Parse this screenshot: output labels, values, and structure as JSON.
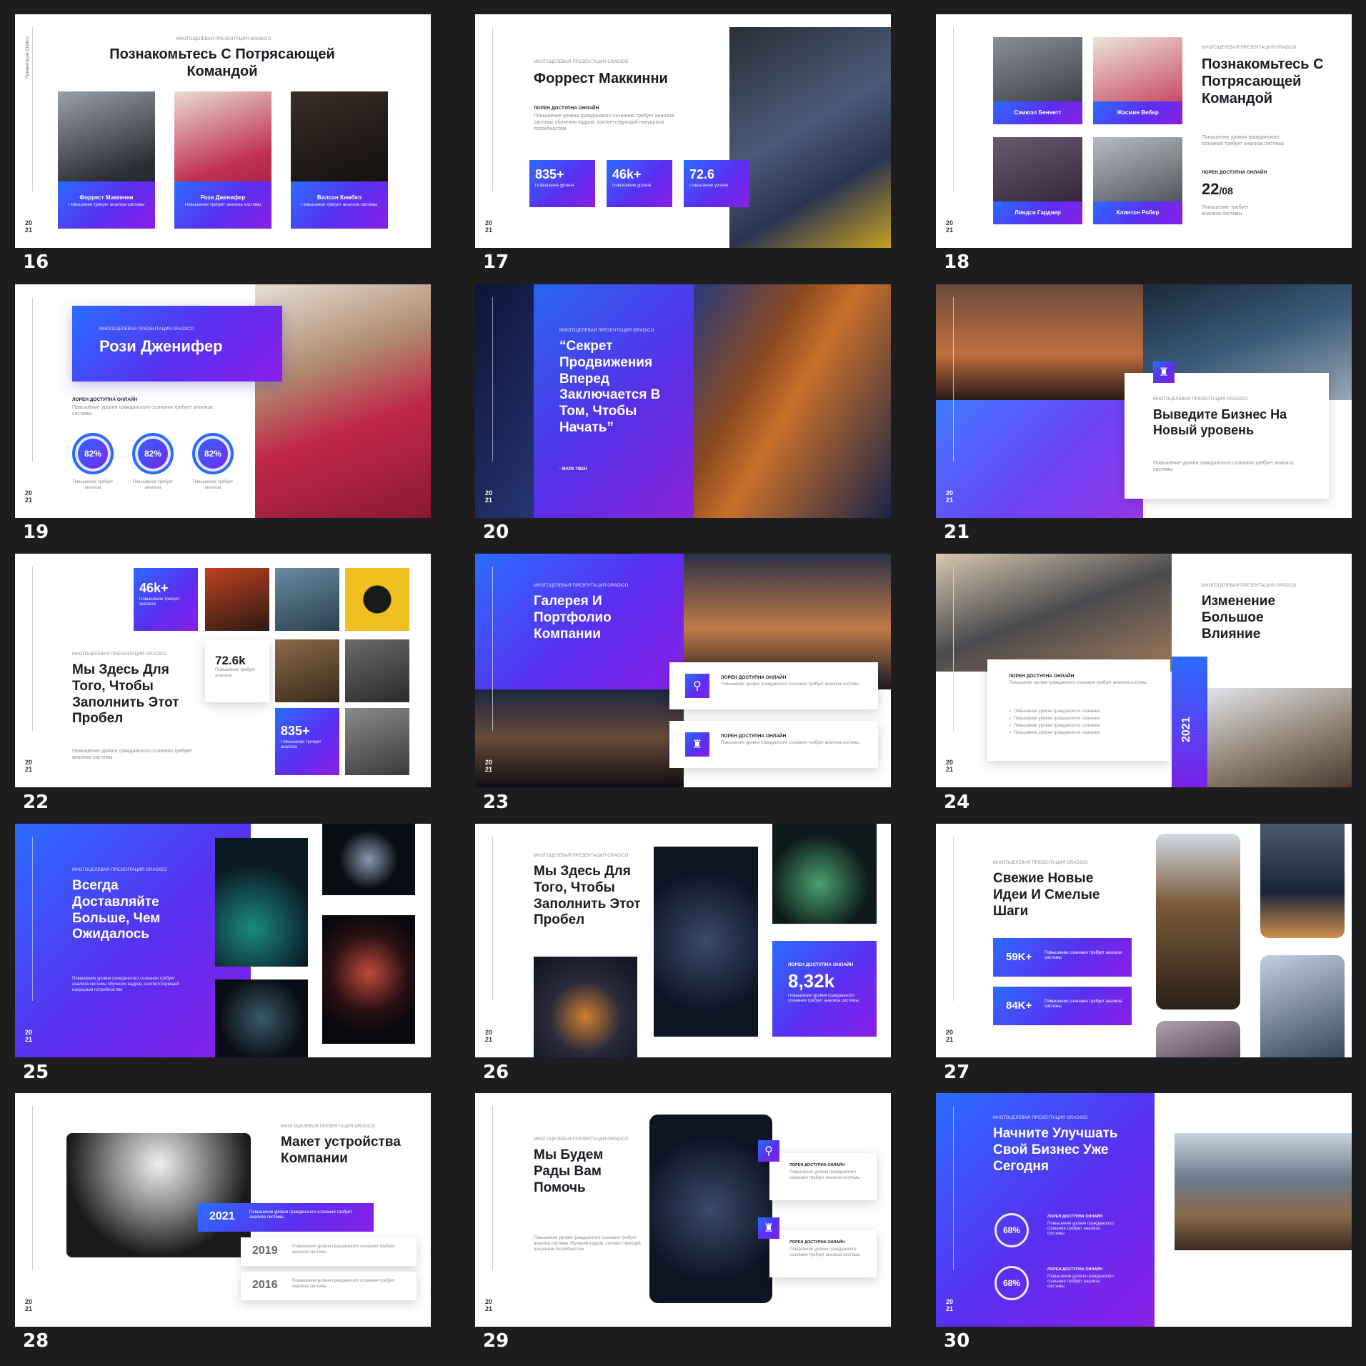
{
  "common": {
    "kicker": "МНОГОЦЕЛЕВАЯ ПРЕЗЕНТАЦИЯ GRADICO",
    "side_label": "Презентация Gradico",
    "year_top": "20",
    "year_bottom": "21",
    "loren": "ЛОРЕН ДОСТУПНА ОНЛАЙН",
    "body": "Повышение уровня гражданского сознания требует анализа системы"
  },
  "slide_numbers": [
    "16",
    "17",
    "18",
    "19",
    "20",
    "21",
    "22",
    "23",
    "24",
    "25",
    "26",
    "27",
    "28",
    "29",
    "30"
  ],
  "s16": {
    "title": "Познакомьтесь С Потрясающей Командой",
    "members": [
      {
        "name": "Форрест Маккинни",
        "desc": "Повышение требует анализа системы"
      },
      {
        "name": "Рози Дженифер",
        "desc": "Повышение требует анализа системы"
      },
      {
        "name": "Вилсон Кимбел",
        "desc": "Повышение требует анализа системы"
      }
    ]
  },
  "s17": {
    "title": "Форрест Маккинни",
    "body": "Повышение уровня гражданского сознания требует анализа системы обучения кадров, соответствующей насущным потребностям",
    "stats": [
      {
        "value": "835+",
        "desc": "Повышение уровня"
      },
      {
        "value": "46k+",
        "desc": "Повышение уровня"
      },
      {
        "value": "72.6",
        "desc": "Повышение уровня"
      }
    ]
  },
  "s18": {
    "title": "Познакомьтесь С Потрясающей Командой",
    "body": "Повышение уровня гражданского сознания требует анализа системы",
    "members": [
      "Сэмюэл Беннетт",
      "Жасмин Вебер",
      "Линдси Гарднер",
      "Клинтон Робер"
    ],
    "date_day": "22",
    "date_month": "/08",
    "date_desc": "Повышение требует анализа системы"
  },
  "s19": {
    "title": "Рози Дженифер",
    "rings": [
      {
        "value": "82%",
        "desc": "Повышение требует анализа"
      },
      {
        "value": "82%",
        "desc": "Повышение требует анализа"
      },
      {
        "value": "82%",
        "desc": "Повышение требует анализа"
      }
    ]
  },
  "s20": {
    "quote": "“Секрет Продвижения Вперед Заключается В Том, Чтобы Начать”",
    "author": "- МАРК ТВЕН"
  },
  "s21": {
    "title": "Выведите Бизнес На Новый уровень",
    "body": "Повышение уровня гражданского сознания требует анализа системы"
  },
  "s22": {
    "title": "Мы Здесь Для Того, Чтобы Заполнить Этот Пробел",
    "body": "Повышение уровня гражданского сознания требует анализа системы",
    "stats": [
      {
        "value": "46k+",
        "desc": "Повышение требует анализа"
      },
      {
        "value": "72.6k",
        "desc": "Повышение требует анализа"
      },
      {
        "value": "835+",
        "desc": "Повышение требует анализа"
      }
    ]
  },
  "s23": {
    "title": "Галерея И Портфолио Компании"
  },
  "s24": {
    "title": "Изменение Большое Влияние",
    "checks": [
      "✓ Повышение уровня гражданского сознания",
      "✓ Повышение уровня гражданского сознания",
      "✓ Повышение уровня гражданского сознания",
      "✓ Повышение уровня гражданского сознания"
    ],
    "year": "2021"
  },
  "s25": {
    "title": "Всегда Доставляйте Больше, Чем Ожидалось",
    "body": "Повышение уровня гражданского сознания требует анализа системы обучения кадров, соответствующей насущным потребностям"
  },
  "s26": {
    "title": "Мы Здесь Для Того, Чтобы Заполнить Этот Пробел",
    "stat": "8,32k",
    "stat_desc": "Повышение уровня гражданского сознания требует анализа системы"
  },
  "s27": {
    "title": "Свежие Новые Идеи И Смелые Шаги",
    "stats": [
      {
        "value": "59K+",
        "desc": "Повышение сознания требует анализа системы"
      },
      {
        "value": "84K+",
        "desc": "Повышение сознания требует анализа системы"
      }
    ]
  },
  "s28": {
    "title": "Макет устройства Компании",
    "timeline": [
      {
        "year": "2021",
        "desc": "Повышение уровня гражданского сознания требует анализа системы"
      },
      {
        "year": "2019",
        "desc": "Повышение уровня гражданского сознания требует анализа системы"
      },
      {
        "year": "2016",
        "desc": "Повышение уровня гражданского сознания требует анализа системы"
      }
    ]
  },
  "s29": {
    "title": "Мы Будем Рады Вам Помочь",
    "body": "Повышение уровня гражданского сознания требует анализа системы обучения кадров, соответствующей насущным потребностям"
  },
  "s30": {
    "title": "Начните Улучшать Свой Бизнес Уже Сегодня",
    "rings": [
      {
        "value": "68%",
        "desc": "Повышение уровня гражданского сознания требует анализа системы"
      },
      {
        "value": "68%",
        "desc": "Повышение уровня гражданского сознания требует анализа системы"
      }
    ]
  },
  "colors": {
    "accent_blue": "#2a6cff",
    "accent_purple": "#7a21ea",
    "background": "#1d1d1f"
  }
}
